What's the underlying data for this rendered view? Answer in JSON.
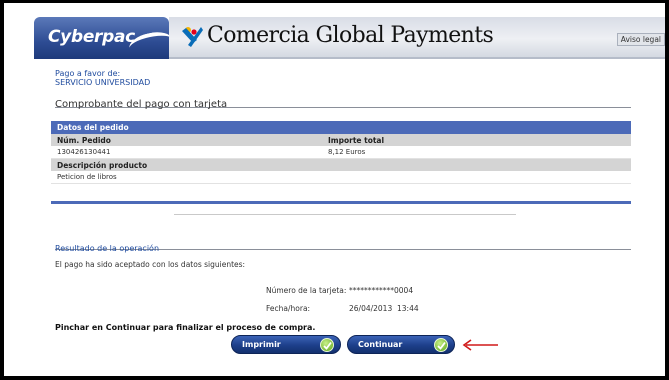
{
  "header": {
    "cyberpac_logo": "Cyberpac",
    "brand": "Comercia Global Payments",
    "aviso_legal": "Aviso legal"
  },
  "merchant": {
    "pago_a_favor_label": "Pago a favor de:",
    "pago_a_favor_value": "SERVICIO UNIVERSIDAD"
  },
  "page_title": "Comprobante del pago con tarjeta",
  "pedido": {
    "section_title": "Datos del pedido",
    "col_num_pedido": "Núm. Pedido",
    "col_importe": "Importe total",
    "num_pedido": "130426130441",
    "importe": "8,12 Euros",
    "col_descripcion": "Descripción producto",
    "descripcion": "Peticion de libros"
  },
  "resultado": {
    "title": "Resultado de la operación",
    "mensaje": "El pago ha sido aceptado con los datos siguientes:",
    "tarjeta_label": "Número de la tarjeta:",
    "tarjeta_value": "************0004",
    "fecha_label": "Fecha/hora:",
    "fecha_value": "26/04/2013  13:44"
  },
  "instruccion": "Pinchar en Continuar para finalizar el proceso de compra.",
  "buttons": {
    "imprimir": "Imprimir",
    "continuar": "Continuar"
  },
  "colors": {
    "accent_blue": "#4c6ab8",
    "link_blue": "#1f4b9e",
    "button_blue": "#1d3f8a",
    "arrow_red": "#d01818"
  },
  "icons": [
    "cyberpac-swoosh-icon",
    "lacaixa-star-icon",
    "check-icon",
    "red-arrow-icon"
  ]
}
